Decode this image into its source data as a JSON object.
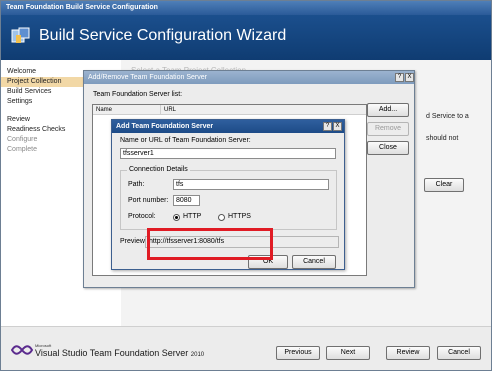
{
  "wizard": {
    "window_title": "Team Foundation Build Service Configuration",
    "header_title": "Build Service Configuration Wizard",
    "nav": {
      "welcome": "Welcome",
      "project_collection": "Project Collection",
      "build_services": "Build Services",
      "settings": "Settings",
      "review": "Review",
      "readiness_checks": "Readiness Checks",
      "configure": "Configure",
      "complete": "Complete"
    },
    "background": {
      "heading": "Select a Team Project Collection",
      "text1": "d Service to a",
      "text2": "should not",
      "clear_label": "Clear"
    },
    "footer": {
      "brand_small": "Microsoft",
      "brand": "Visual Studio Team Foundation Server",
      "year": "2010",
      "previous_label": "Previous",
      "next_label": "Next",
      "review_label": "Review",
      "cancel_label": "Cancel"
    }
  },
  "add_remove_dialog": {
    "title": "Add/Remove Team Foundation Server",
    "list_label": "Team Foundation Server list:",
    "col_name": "Name",
    "col_url": "URL",
    "add_label": "Add...",
    "remove_label": "Remove",
    "close_label": "Close",
    "help_glyph": "?",
    "close_glyph": "X"
  },
  "add_server_dialog": {
    "title": "Add Team Foundation Server",
    "name_label": "Name or URL of Team Foundation Server:",
    "name_value": "tfsserver1",
    "connection_group": "Connection Details",
    "path_label": "Path:",
    "path_value": "tfs",
    "port_label": "Port number:",
    "port_value": "8080",
    "protocol_label": "Protocol:",
    "protocol_options": [
      "HTTP",
      "HTTPS"
    ],
    "protocol_selected": "HTTP",
    "preview_label": "Preview",
    "preview_value": "http://tfsserver1:8080/tfs",
    "ok_label": "OK",
    "cancel_label": "Cancel",
    "help_glyph": "?",
    "close_glyph": "X"
  },
  "colors": {
    "header_blue": "#1b4f8d",
    "nav_active": "#f2d8a6",
    "highlight_red": "#e01b24"
  }
}
